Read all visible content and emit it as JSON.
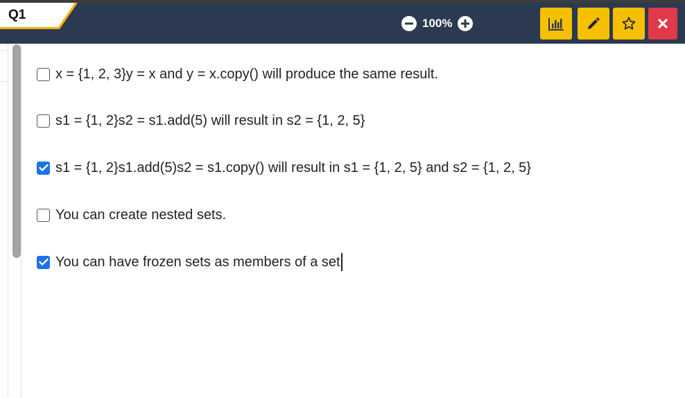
{
  "header": {
    "question_tab": "Q1",
    "zoom": {
      "value": "100%"
    },
    "toolbar": {
      "stats_icon": "bar-chart-icon",
      "edit_icon": "pencil-icon",
      "favorite_icon": "star-icon",
      "close_icon": "close-icon"
    },
    "colors": {
      "bar": "#2b3a50",
      "tab_accent": "#f6b400",
      "button_yellow": "#f6c000",
      "button_red": "#e0394a",
      "checkbox_checked": "#1a73e8"
    }
  },
  "options": [
    {
      "text": "x = {1, 2, 3}y = x and y = x.copy() will produce the same result.",
      "checked": false
    },
    {
      "text": "s1 = {1, 2}s2 = s1.add(5) will result in s2 = {1, 2, 5}",
      "checked": false
    },
    {
      "text": "s1 = {1, 2}s1.add(5)s2 = s1.copy() will result in s1 = {1, 2, 5} and s2 = {1, 2, 5}",
      "checked": true
    },
    {
      "text": "You can create nested sets.",
      "checked": false
    },
    {
      "text": "You can have frozen sets as members of a set",
      "checked": true
    }
  ]
}
